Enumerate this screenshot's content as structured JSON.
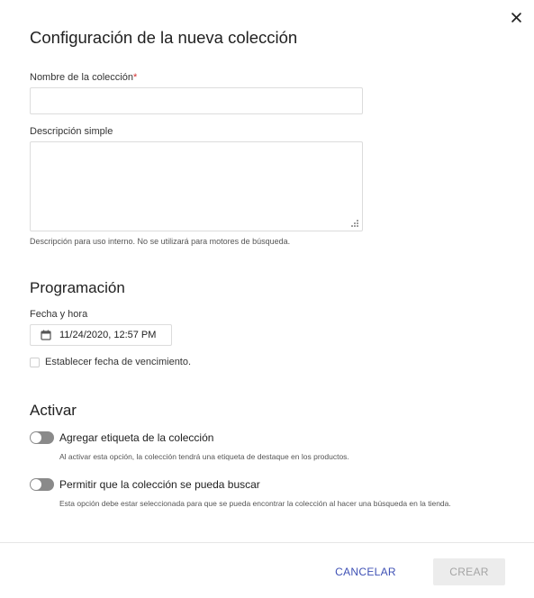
{
  "dialog": {
    "title": "Configuración de la nueva colección",
    "close_icon": "close-icon"
  },
  "form": {
    "name_label": "Nombre de la colección",
    "name_required_mark": "*",
    "name_value": "",
    "description_label": "Descripción simple",
    "description_value": "",
    "description_help": "Descripción para uso interno. No se utilizará para motores de búsqueda."
  },
  "schedule": {
    "title": "Programación",
    "datetime_label": "Fecha y hora",
    "datetime_value": "11/24/2020, 12:57 PM",
    "calendar_icon": "calendar-icon",
    "expiry_label": "Establecer fecha de vencimiento.",
    "expiry_checked": false
  },
  "activate": {
    "title": "Activar",
    "toggles": [
      {
        "label": "Agregar etiqueta de la colección",
        "description": "Al activar esta opción, la colección tendrá una etiqueta de destaque en los productos.",
        "on": false
      },
      {
        "label": "Permitir que la colección se pueda buscar",
        "description": "Esta opción debe estar seleccionada para que se pueda encontrar la colección al hacer una búsqueda en la tienda.",
        "on": false
      }
    ]
  },
  "footer": {
    "cancel_label": "CANCELAR",
    "create_label": "CREAR",
    "accent_color": "#3f51b5"
  }
}
